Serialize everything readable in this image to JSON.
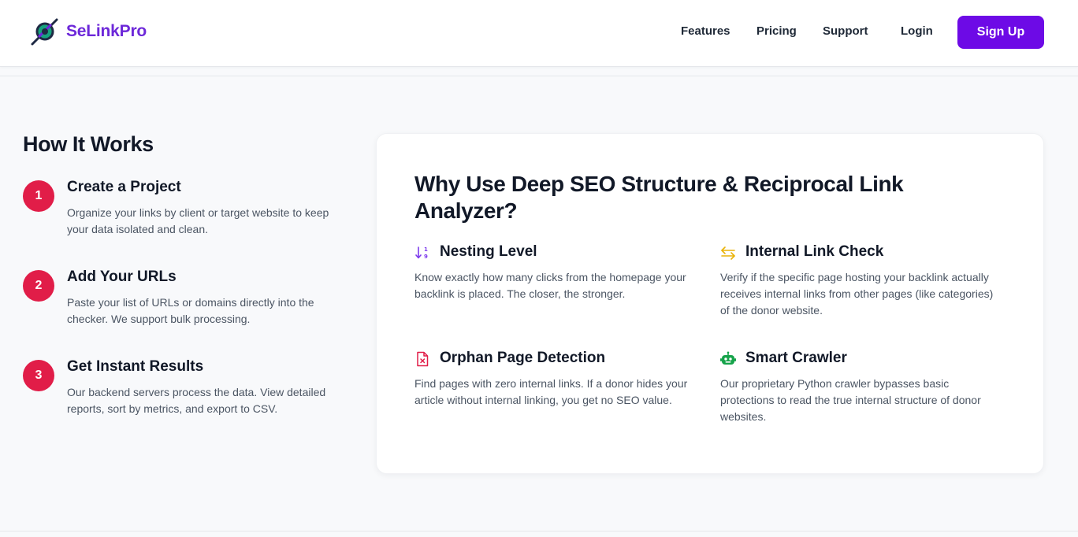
{
  "header": {
    "brand": "SeLinkPro",
    "nav": {
      "features": "Features",
      "pricing": "Pricing",
      "support": "Support",
      "login": "Login",
      "signup": "Sign Up"
    }
  },
  "how_it_works": {
    "title": "How It Works",
    "steps": [
      {
        "number": "1",
        "title": "Create a Project",
        "description": "Organize your links by client or target website to keep your data isolated and clean."
      },
      {
        "number": "2",
        "title": "Add Your URLs",
        "description": "Paste your list of URLs or domains directly into the checker. We support bulk processing."
      },
      {
        "number": "3",
        "title": "Get Instant Results",
        "description": "Our backend servers process the data. View detailed reports, sort by metrics, and export to CSV."
      }
    ]
  },
  "why": {
    "title": "Why Use Deep SEO Structure & Reciprocal Link Analyzer?",
    "features": [
      {
        "icon": "sort-numeric-icon",
        "title": "Nesting Level",
        "description": "Know exactly how many clicks from the homepage your backlink is placed. The closer, the stronger."
      },
      {
        "icon": "arrows-exchange-icon",
        "title": "Internal Link Check",
        "description": "Verify if the specific page hosting your backlink actually receives internal links from other pages (like categories) of the donor website."
      },
      {
        "icon": "file-x-icon",
        "title": "Orphan Page Detection",
        "description": "Find pages with zero internal links. If a donor hides your article without internal linking, you get no SEO value."
      },
      {
        "icon": "robot-icon",
        "title": "Smart Crawler",
        "description": "Our proprietary Python crawler bypasses basic protections to read the true internal structure of donor websites."
      }
    ]
  },
  "colors": {
    "brand": "#6d28d9",
    "signup_button": "#6d0ae6",
    "step_badge": "#e11d48",
    "icon_nesting": "#7c3aed",
    "icon_internal": "#eab308",
    "icon_orphan": "#e11d48",
    "icon_crawler": "#16a34a"
  }
}
